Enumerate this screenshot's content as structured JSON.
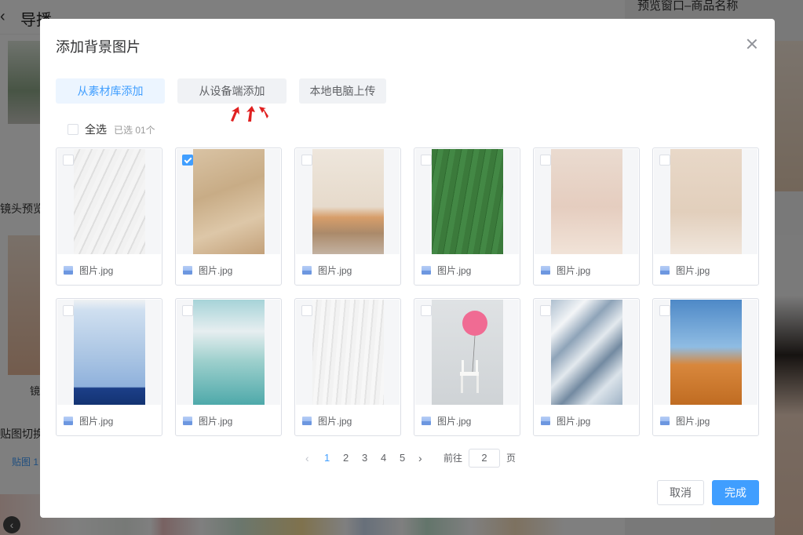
{
  "background": {
    "page_title": "导播",
    "back_icon": "chevron-left-icon",
    "preview_title": "预览窗口–商品名称",
    "lens_label": "镜头预览",
    "mirror_label": "镜",
    "switch_label": "贴图切换",
    "tab_label": "贴图 1"
  },
  "dialog": {
    "title": "添加背景图片",
    "close_icon": "close-icon",
    "tabs": [
      {
        "label": "从素材库添加",
        "active": true
      },
      {
        "label": "从设备端添加",
        "active": false
      },
      {
        "label": "本地电脑上传",
        "active": false
      }
    ],
    "select_all": {
      "label": "全选",
      "selected_text": "已选 01个",
      "checked": false
    },
    "images": [
      {
        "name": "图片.jpg",
        "checked": false
      },
      {
        "name": "图片.jpg",
        "checked": true
      },
      {
        "name": "图片.jpg",
        "checked": false
      },
      {
        "name": "图片.jpg",
        "checked": false
      },
      {
        "name": "图片.jpg",
        "checked": false
      },
      {
        "name": "图片.jpg",
        "checked": false
      },
      {
        "name": "图片.jpg",
        "checked": false
      },
      {
        "name": "图片.jpg",
        "checked": false
      },
      {
        "name": "图片.jpg",
        "checked": false
      },
      {
        "name": "图片.jpg",
        "checked": false
      },
      {
        "name": "图片.jpg",
        "checked": false
      },
      {
        "name": "图片.jpg",
        "checked": false
      }
    ],
    "pagination": {
      "pages": [
        "1",
        "2",
        "3",
        "4",
        "5"
      ],
      "current": "1",
      "goto_label": "前往",
      "goto_value": "2",
      "page_suffix": "页"
    },
    "buttons": {
      "cancel": "取消",
      "confirm": "完成"
    },
    "colors": {
      "primary": "#409eff",
      "annotation": "#e02020"
    }
  }
}
